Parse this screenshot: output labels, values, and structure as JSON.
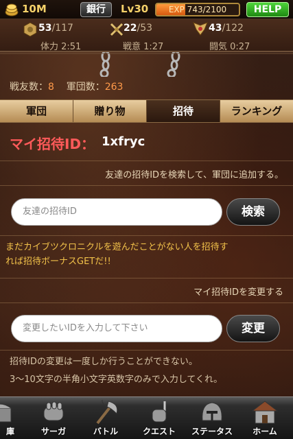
{
  "status_bar": {
    "money": "10M",
    "bank_label": "銀行",
    "level": "Lv30",
    "exp_text": "EXP 743/2100",
    "exp_fraction": 0.354,
    "help_label": "HELP"
  },
  "stats": [
    {
      "current": "53",
      "max": "/117",
      "label": "体力 2:51",
      "icon": "stamina-emblem-icon"
    },
    {
      "current": "22",
      "max": "/53",
      "label": "戦意 1:27",
      "icon": "crossed-swords-icon"
    },
    {
      "current": "43",
      "max": "/122",
      "label": "闘気 0:27",
      "icon": "winged-emblem-icon"
    }
  ],
  "counts": {
    "friends_label": "戦友数：",
    "friends_value": "8",
    "legion_label": "軍団数：",
    "legion_value": "263"
  },
  "tabs": [
    {
      "label": "軍団",
      "active": false
    },
    {
      "label": "贈り物",
      "active": false
    },
    {
      "label": "招待",
      "active": true
    },
    {
      "label": "ランキング",
      "active": false
    }
  ],
  "invite": {
    "my_id_label": "マイ招待ID：",
    "my_id_value": "1xfryc",
    "search_hint": "友達の招待IDを検索して、軍団に追加する。",
    "search_placeholder": "友達の招待ID",
    "search_button": "検索",
    "promo_line1": "まだカイブツクロニクルを遊んだことがない人を招待す",
    "promo_line2": "れば招待ボーナスGETだ!!",
    "change_hint": "マイ招待IDを変更する",
    "change_placeholder": "変更したいIDを入力して下さい",
    "change_button": "変更",
    "note1": "招待IDの変更は一度しか行うことができない。",
    "note2": "3～10文字の半角小文字英数字のみで入力してくれ。"
  },
  "bottom_nav": [
    {
      "label": "庫",
      "icon": "treasure-chest-icon"
    },
    {
      "label": "サーガ",
      "icon": "armored-fist-icon"
    },
    {
      "label": "バトル",
      "icon": "battle-axe-icon"
    },
    {
      "label": "クエスト",
      "icon": "gauntlet-sword-icon"
    },
    {
      "label": "ステータス",
      "icon": "helmet-icon"
    },
    {
      "label": "ホーム",
      "icon": "house-icon"
    }
  ],
  "colors": {
    "accent_gold": "#f6d26a",
    "help_green": "#2fae1f",
    "red_label": "#ff5a5a",
    "promo_yellow": "#f2c24a",
    "count_orange": "#ff9a4a"
  }
}
